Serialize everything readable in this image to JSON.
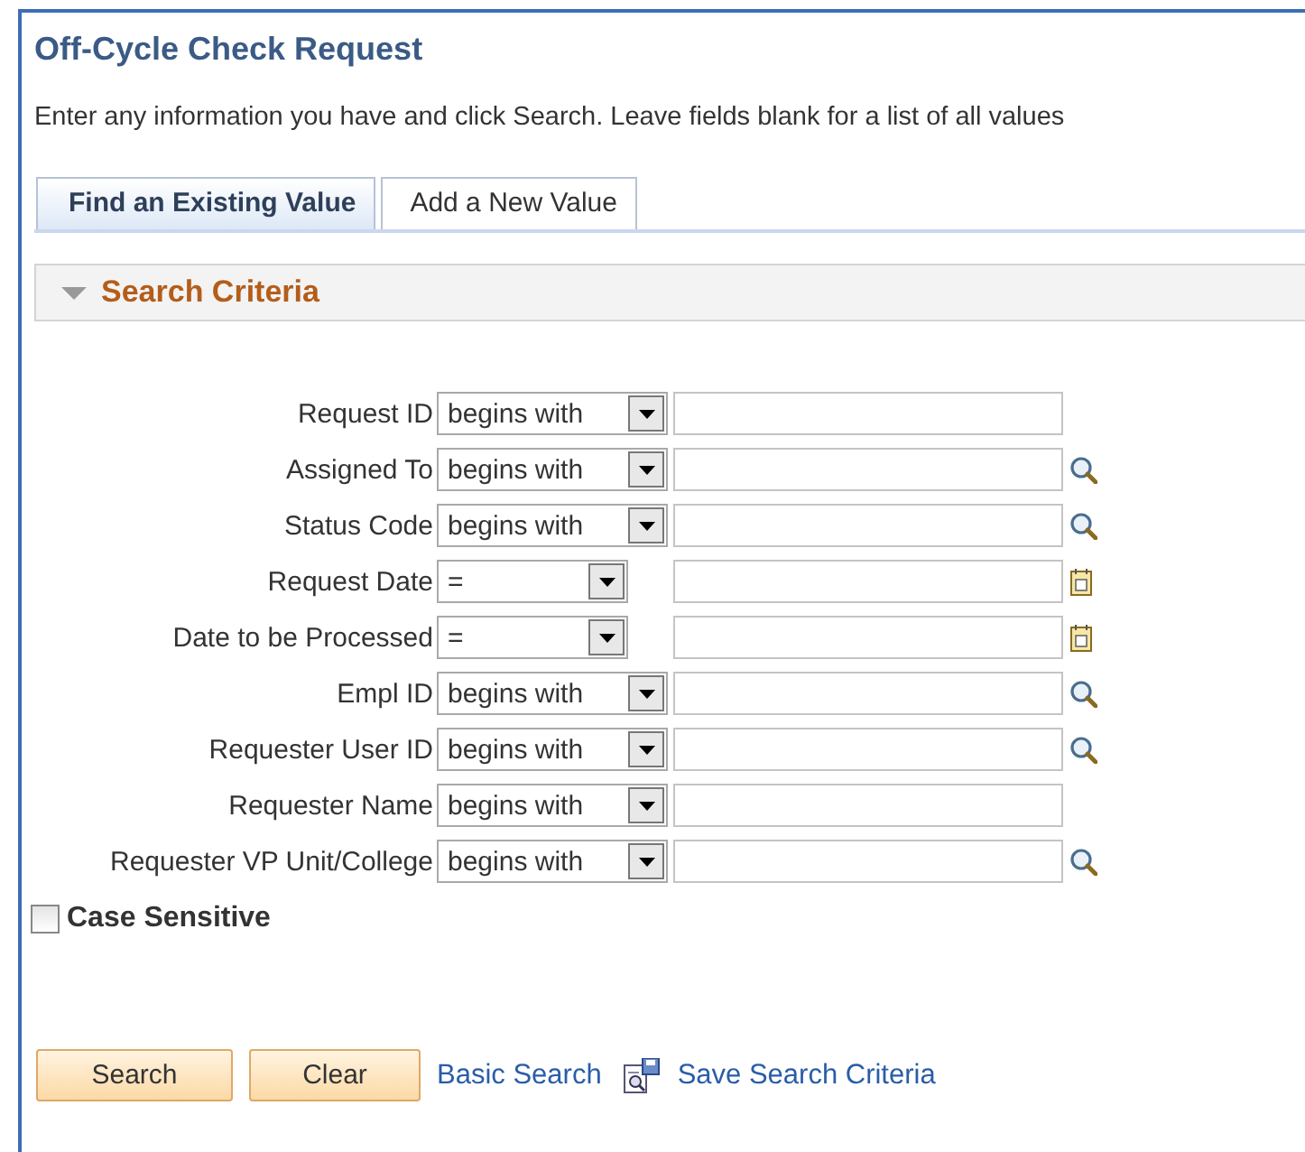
{
  "page": {
    "title": "Off-Cycle Check Request",
    "instructions": "Enter any information you have and click Search. Leave fields blank for a list of all values"
  },
  "tabs": [
    {
      "label": "Find an Existing Value",
      "selected": true
    },
    {
      "label": "Add a New Value",
      "selected": false
    }
  ],
  "section": {
    "title": "Search Criteria",
    "expanded": true
  },
  "fields": [
    {
      "label": "Request ID",
      "kind": "text",
      "operator": "begins with",
      "has_lookup": false
    },
    {
      "label": "Assigned To",
      "kind": "text",
      "operator": "begins with",
      "has_lookup": true
    },
    {
      "label": "Status Code",
      "kind": "text",
      "operator": "begins with",
      "has_lookup": true
    },
    {
      "label": "Request Date",
      "kind": "date",
      "operator": "=",
      "has_lookup": true
    },
    {
      "label": "Date to be Processed",
      "kind": "date",
      "operator": "=",
      "has_lookup": true
    },
    {
      "label": "Empl ID",
      "kind": "text",
      "operator": "begins with",
      "has_lookup": true
    },
    {
      "label": "Requester User ID",
      "kind": "text",
      "operator": "begins with",
      "has_lookup": true
    },
    {
      "label": "Requester Name",
      "kind": "text",
      "operator": "begins with",
      "has_lookup": false
    },
    {
      "label": "Requester VP Unit/College",
      "kind": "text",
      "operator": "begins with",
      "has_lookup": true
    }
  ],
  "case_sensitive": {
    "label": "Case Sensitive",
    "checked": false
  },
  "actions": [
    {
      "kind": "button",
      "label": "Search"
    },
    {
      "kind": "button",
      "label": "Clear"
    },
    {
      "kind": "link",
      "label": "Basic Search"
    },
    {
      "kind": "iconlink",
      "label": "Save Search Criteria"
    }
  ]
}
